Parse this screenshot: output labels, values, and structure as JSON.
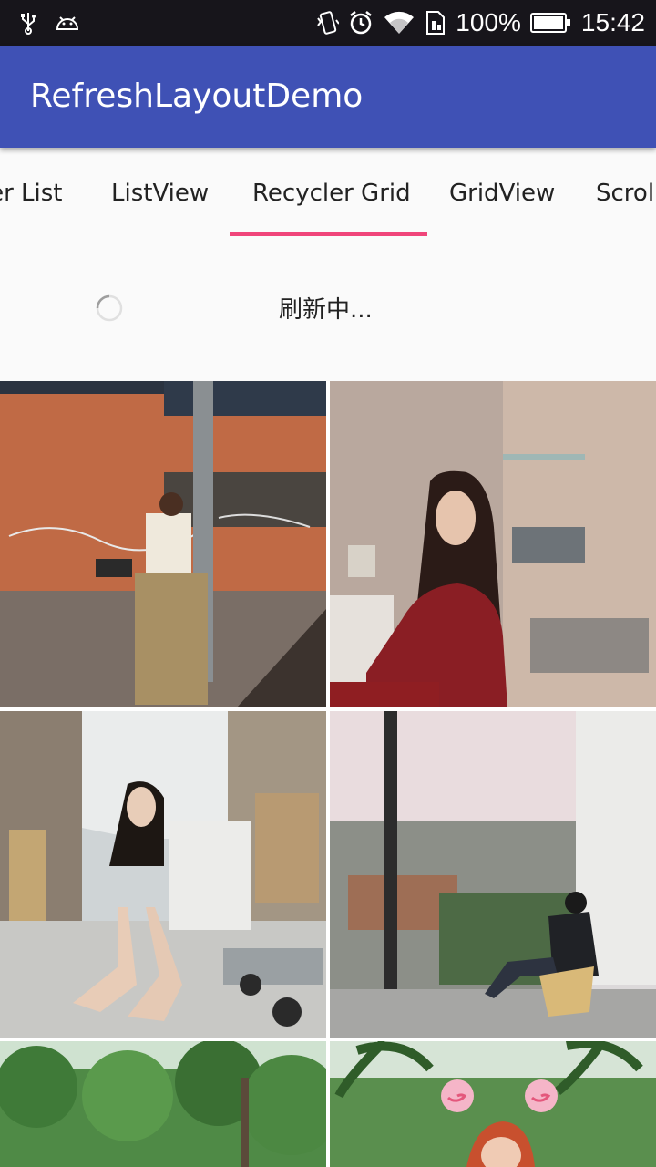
{
  "status_bar": {
    "battery_percent": "100%",
    "time": "15:42",
    "icons": [
      "usb-icon",
      "android-debug-icon",
      "vibrate-icon",
      "alarm-icon",
      "wifi-icon",
      "sim-icon",
      "battery-icon"
    ]
  },
  "app_bar": {
    "title": "RefreshLayoutDemo",
    "color": "#3f51b5"
  },
  "tabs": [
    {
      "label": "Recycler List",
      "selected": false
    },
    {
      "label": "ListView",
      "selected": false
    },
    {
      "label": "Recycler Grid",
      "selected": true
    },
    {
      "label": "GridView",
      "selected": false
    },
    {
      "label": "ScrollView",
      "selected": false
    }
  ],
  "tab_indicator_color": "#f0457a",
  "refresh": {
    "text": "刷新中..."
  },
  "grid": {
    "photos": [
      {
        "subject": "woman by brick wall with graffiti"
      },
      {
        "subject": "woman in red pajamas in bathroom"
      },
      {
        "subject": "woman sitting on cart in warehouse"
      },
      {
        "subject": "woman sitting by window over city view"
      },
      {
        "subject": "trees in a park"
      },
      {
        "subject": "woman with lollipop sticker among palm trees"
      }
    ]
  }
}
